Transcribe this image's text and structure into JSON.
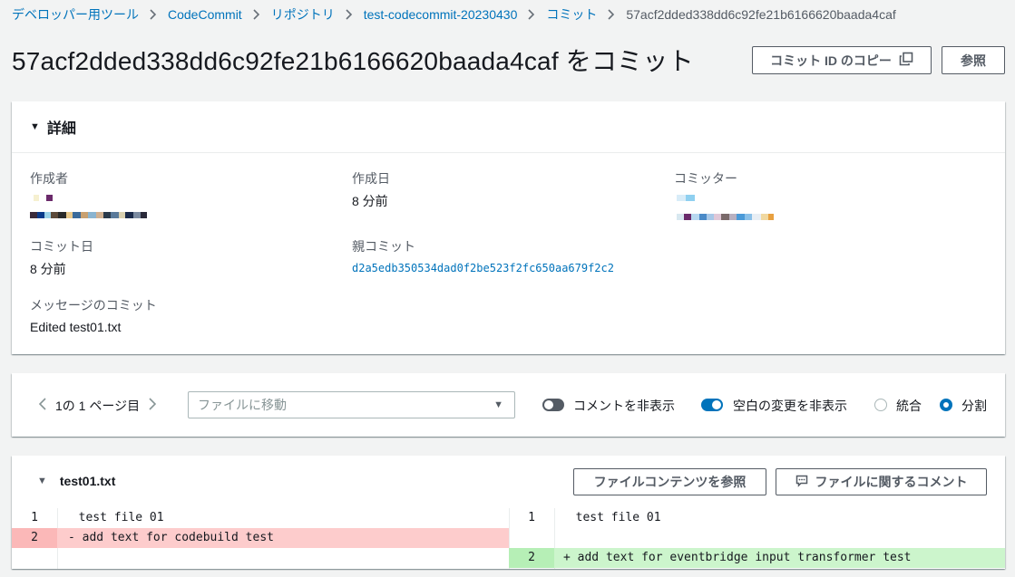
{
  "breadcrumb": {
    "items": [
      "デベロッパー用ツール",
      "CodeCommit",
      "リポジトリ",
      "test-codecommit-20230430",
      "コミット"
    ],
    "current": "57acf2dded338dd6c92fe21b6166620baada4caf"
  },
  "header": {
    "title": "57acf2dded338dd6c92fe21b6166620baada4caf をコミット",
    "copy_button": "コミット ID のコピー",
    "browse_button": "参照"
  },
  "details": {
    "section_title": "詳細",
    "author_label": "作成者",
    "created_label": "作成日",
    "created_value": "8 分前",
    "committer_label": "コミッター",
    "commit_date_label": "コミット日",
    "commit_date_value": "8 分前",
    "parent_label": "親コミット",
    "parent_value": "d2a5edb350534dad0f2be523f2fc650aa679f2c2",
    "message_label": "メッセージのコミット",
    "message_value": "Edited test01.txt"
  },
  "toolbar": {
    "pager_text": "1の 1 ページ目",
    "file_select_placeholder": "ファイルに移動",
    "hide_comments_label": "コメントを非表示",
    "hide_comments_on": false,
    "hide_whitespace_label": "空白の変更を非表示",
    "hide_whitespace_on": true,
    "unified_label": "統合",
    "split_label": "分割",
    "selected_view": "split"
  },
  "file": {
    "name": "test01.txt",
    "view_contents_button": "ファイルコンテンツを参照",
    "comment_button": "ファイルに関するコメント",
    "left": {
      "line1_no": "1",
      "line1_text": "  test file 01",
      "line2_no": "2",
      "line2_text": "- add text for codebuild test"
    },
    "right": {
      "line1_no": "1",
      "line1_text": "  test file 01",
      "line2_no": "2",
      "line2_text": "+ add text for eventbridge input transformer test"
    }
  },
  "colors": {
    "link": "#0073bb",
    "deleted_bg": "#fdcccc",
    "added_bg": "#ccf5cc",
    "toggle_on": "#0073bb"
  }
}
